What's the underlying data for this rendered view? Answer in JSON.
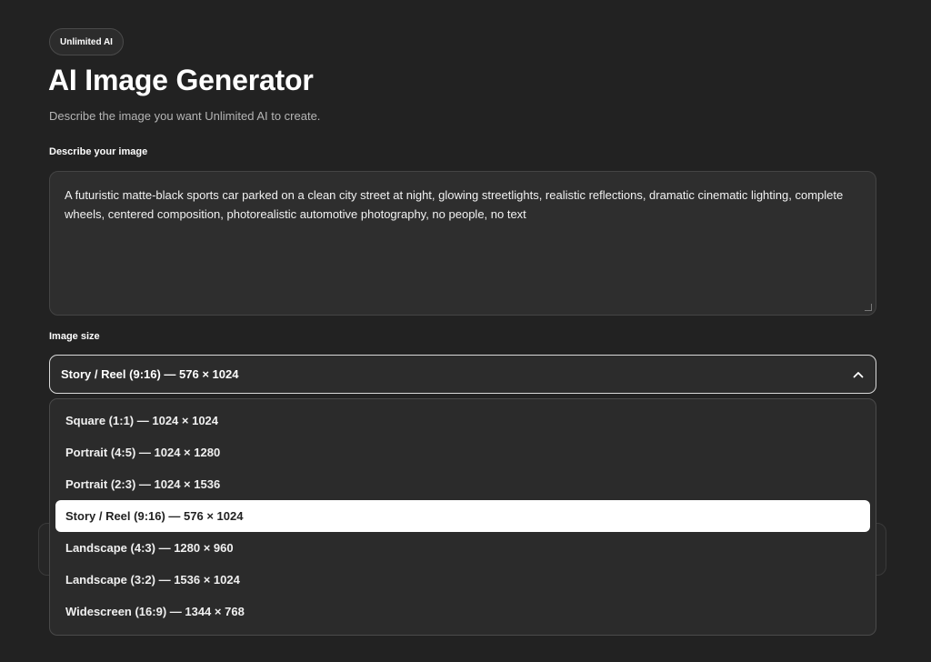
{
  "badge": "Unlimited AI",
  "title": "AI Image Generator",
  "subtitle": "Describe the image you want Unlimited AI to create.",
  "prompt": {
    "label": "Describe your image",
    "value": "A futuristic matte-black sports car parked on a clean city street at night, glowing streetlights, realistic reflections, dramatic cinematic lighting, complete wheels, centered composition, photorealistic automotive photography, no people, no text"
  },
  "image_size": {
    "label": "Image size",
    "selected": "Story / Reel (9:16) — 576 × 1024",
    "chevron_icon": "chevron-up-icon",
    "options": [
      "Square (1:1) — 1024 × 1024",
      "Portrait (4:5) — 1024 × 1280",
      "Portrait (2:3) — 1024 × 1536",
      "Story / Reel (9:16) — 576 × 1024",
      "Landscape (4:3) — 1280 × 960",
      "Landscape (3:2) — 1536 × 1024",
      "Widescreen (16:9) — 1344 × 768"
    ],
    "selected_index": 3
  },
  "colors": {
    "background": "#222222",
    "panel": "#2c2c2c",
    "highlight": "#ffffff"
  }
}
